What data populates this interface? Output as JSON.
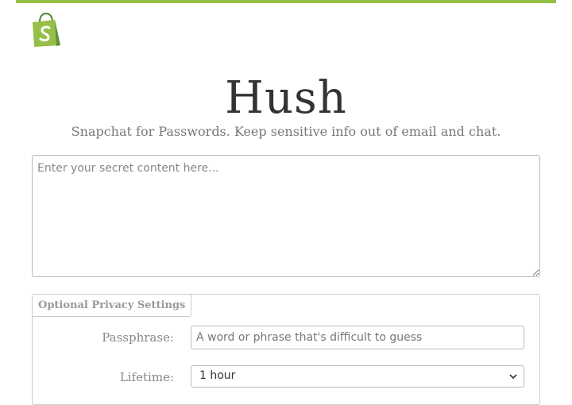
{
  "header": {
    "logo_icon": "shopify-bag-icon",
    "accent_color": "#95bf47"
  },
  "hero": {
    "title": "Hush",
    "tagline": "Snapchat for Passwords. Keep sensitive info out of email and chat."
  },
  "secret": {
    "placeholder": "Enter your secret content here..."
  },
  "privacy": {
    "legend": "Optional Privacy Settings",
    "passphrase_label": "Passphrase:",
    "passphrase_placeholder": "A word or phrase that's difficult to guess",
    "lifetime_label": "Lifetime:",
    "lifetime_value": "1 hour",
    "lifetime_icon": "chevron-down-icon"
  }
}
